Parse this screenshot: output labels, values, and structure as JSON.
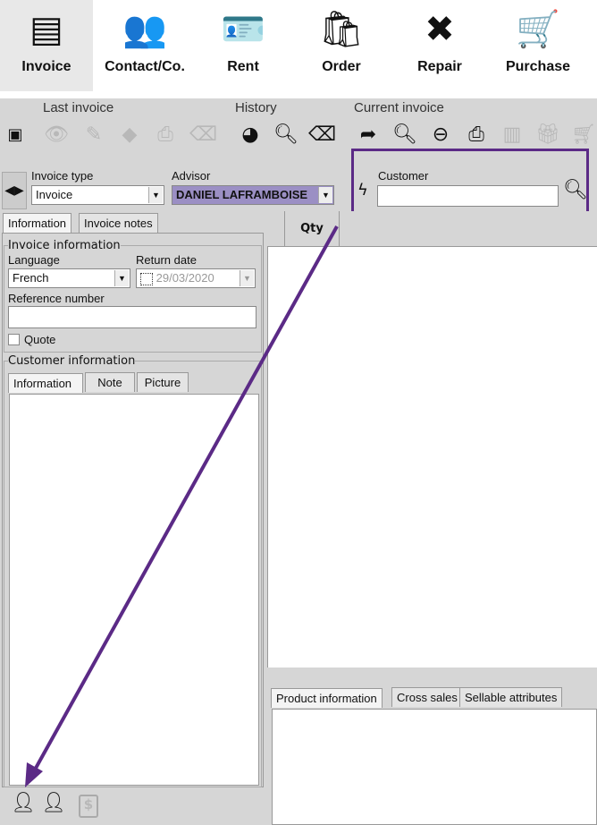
{
  "nav": [
    {
      "label": "Invoice",
      "icon": "invoice-icon"
    },
    {
      "label": "Contact/Co.",
      "icon": "contacts-icon"
    },
    {
      "label": "Rent",
      "icon": "badge-icon"
    },
    {
      "label": "Order",
      "icon": "bag-icon"
    },
    {
      "label": "Repair",
      "icon": "tools-icon"
    },
    {
      "label": "Purchase",
      "icon": "cart-icon"
    }
  ],
  "toolbar": {
    "last_invoice": "Last invoice",
    "history": "History",
    "current_invoice": "Current invoice"
  },
  "form": {
    "invoice_type_label": "Invoice type",
    "invoice_type": "Invoice",
    "advisor_label": "Advisor",
    "advisor": "DANIEL LAFRAMBOISE",
    "advisor_color": "#9b8fc4",
    "customer_label": "Customer",
    "customer_value": ""
  },
  "left_tabs": [
    "Information",
    "Invoice notes"
  ],
  "invoice_info": {
    "legend": "Invoice information",
    "language_label": "Language",
    "language": "French",
    "return_date_label": "Return date",
    "return_date": "29/03/2020",
    "reference_label": "Reference number",
    "reference": "",
    "quote_label": "Quote"
  },
  "customer_info": {
    "legend": "Customer information",
    "tabs": [
      "Information",
      "Note",
      "Picture"
    ]
  },
  "grid": {
    "qty_header": "Qty"
  },
  "bottom_tabs": [
    "Product information",
    "Cross sales",
    "Sellable attributes"
  ],
  "annotation_color": "#5b2a86"
}
